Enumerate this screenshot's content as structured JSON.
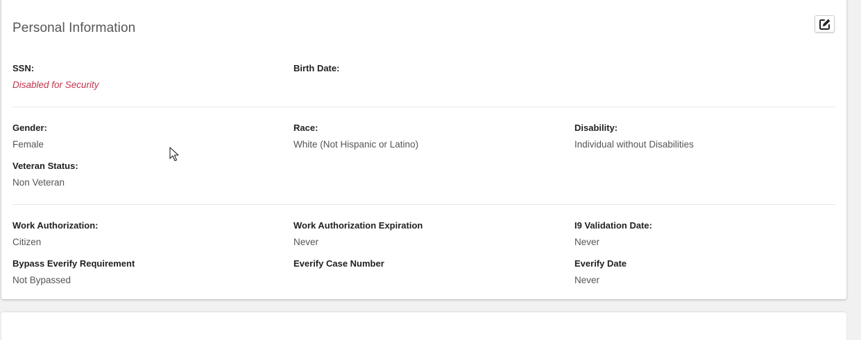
{
  "section": {
    "title": "Personal Information"
  },
  "fields": {
    "ssn": {
      "label": "SSN:",
      "value": "Disabled for Security"
    },
    "birth_date": {
      "label": "Birth Date:",
      "value": ""
    },
    "gender": {
      "label": "Gender:",
      "value": "Female"
    },
    "race": {
      "label": "Race:",
      "value": "White (Not Hispanic or Latino)"
    },
    "disability": {
      "label": "Disability:",
      "value": "Individual without Disabilities"
    },
    "veteran_status": {
      "label": "Veteran Status:",
      "value": "Non Veteran"
    },
    "work_authorization": {
      "label": "Work Authorization:",
      "value": "Citizen"
    },
    "work_authorization_expiration": {
      "label": "Work Authorization Expiration",
      "value": "Never"
    },
    "i9_validation_date": {
      "label": "I9 Validation Date:",
      "value": "Never"
    },
    "bypass_everify": {
      "label": "Bypass Everify Requirement",
      "value": "Not Bypassed"
    },
    "everify_case_number": {
      "label": "Everify Case Number",
      "value": ""
    },
    "everify_date": {
      "label": "Everify Date",
      "value": "Never"
    }
  },
  "icons": {
    "edit": "edit-icon",
    "cursor": "mouse-pointer-icon"
  },
  "colors": {
    "secure_text": "#c2334d",
    "label_text": "#1f1f1f",
    "value_text": "#555555"
  }
}
